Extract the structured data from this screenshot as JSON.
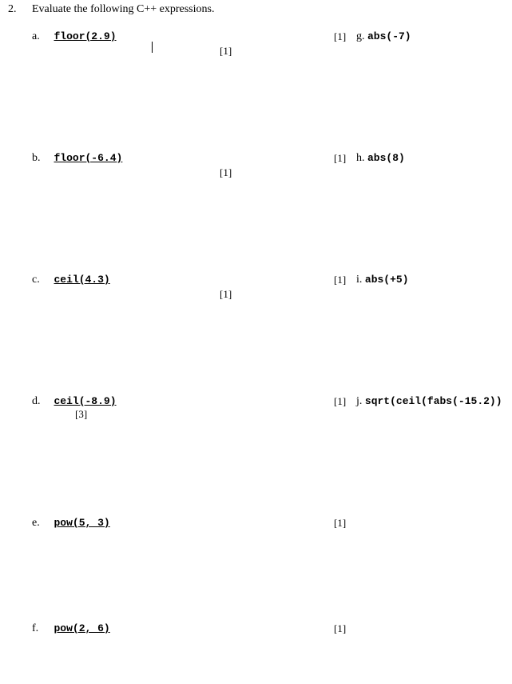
{
  "question": {
    "number": "2.",
    "text": "Evaluate the following C++ expressions."
  },
  "items": [
    {
      "left": {
        "label": "a.",
        "expr": "floor(2.9)",
        "underline": true,
        "marks": "[1]",
        "marksStyle": "normal",
        "cursor": true
      },
      "right": {
        "label": "g.",
        "expr": "abs(-7)",
        "marks": "[1]"
      }
    },
    {
      "left": {
        "label": "b.",
        "expr": "floor(-6.4)",
        "underline": true,
        "marks": "[1]",
        "marksStyle": "normal"
      },
      "right": {
        "label": "h.",
        "expr": "abs(8)",
        "marks": "[1]"
      }
    },
    {
      "left": {
        "label": "c.",
        "expr": "ceil(4.3)",
        "underline": true,
        "marks": "[1]",
        "marksStyle": "normal"
      },
      "right": {
        "label": "i.",
        "expr": "abs(+5)",
        "marks": "[1]"
      }
    },
    {
      "left": {
        "label": "d.",
        "expr": "ceil(-8.9)",
        "underline": true,
        "marks": "[3]",
        "marksStyle": "under"
      },
      "right": {
        "label": "j.",
        "expr": "sqrt(ceil(fabs(-15.2))",
        "marks": "[1]"
      }
    },
    {
      "left": {
        "label": "e.",
        "expr": "pow(5, 3)",
        "underline": true
      },
      "right": {
        "marks": "[1]"
      }
    },
    {
      "left": {
        "label": "f.",
        "expr": "pow(2, 6)",
        "underline": true
      },
      "right": {
        "marks": "[1]"
      }
    }
  ]
}
